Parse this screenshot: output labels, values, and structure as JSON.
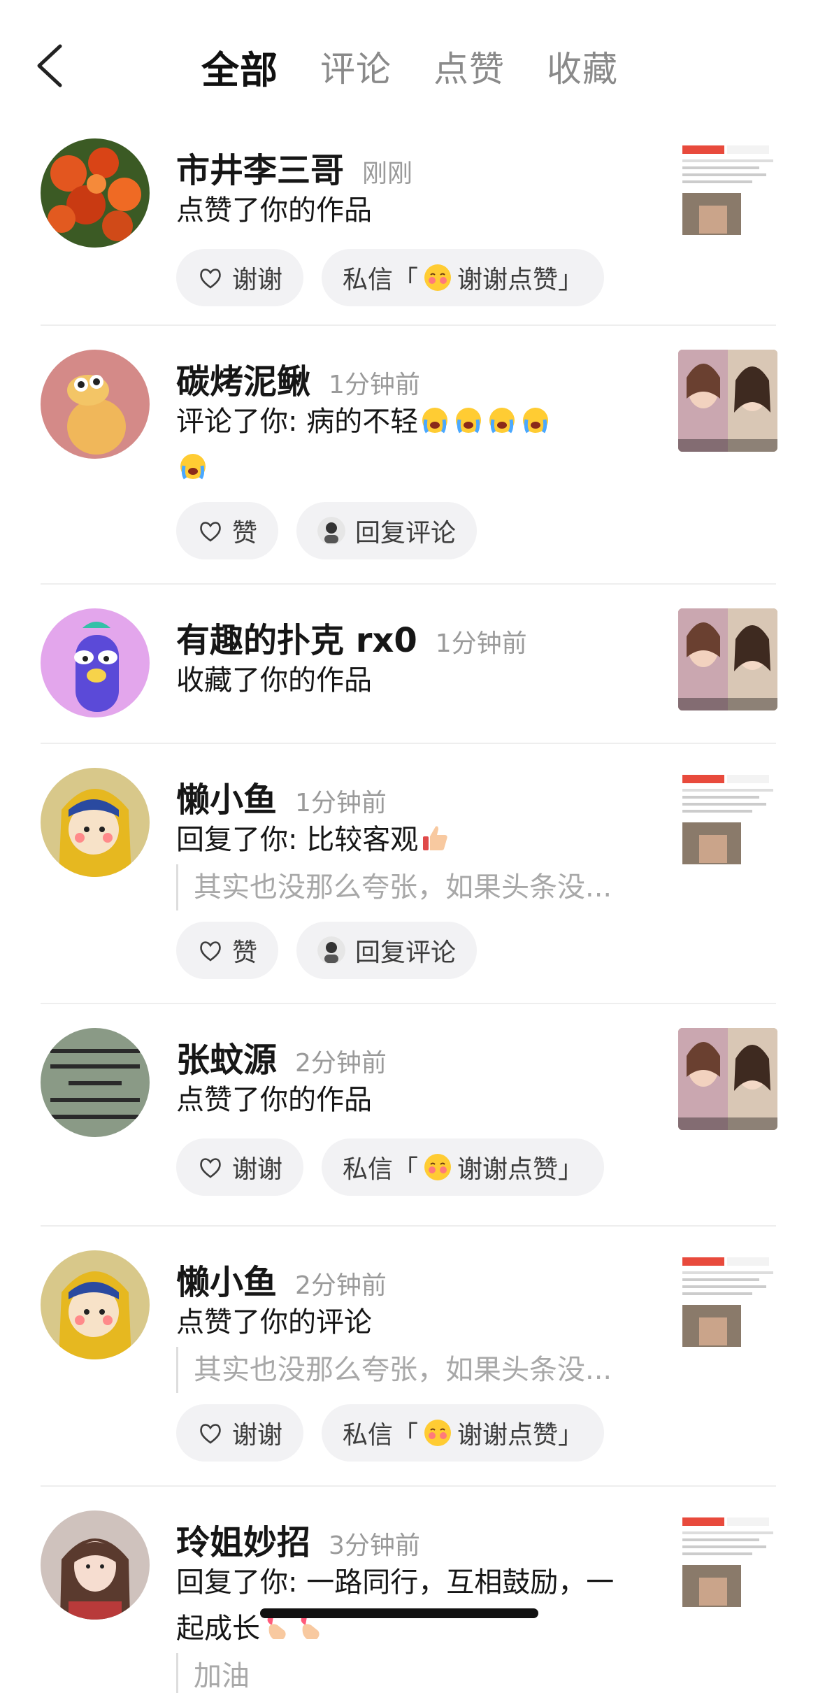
{
  "header": {
    "tabs": [
      "全部",
      "评论",
      "点赞",
      "收藏"
    ],
    "active_tab": 0
  },
  "items": [
    {
      "name": "市井李三哥",
      "time": "刚刚",
      "action": "点赞了你的作品",
      "quote": "",
      "avatar": "red-flowers-avatar",
      "thumb": "screenshot-thumb",
      "buttons": [
        {
          "icon": "heart-hands-icon",
          "label": "谢谢"
        },
        {
          "icon": "",
          "label_before": "私信「",
          "emoji": "blush-emoji",
          "label_after": "谢谢点赞」"
        }
      ]
    },
    {
      "name": "碳烤泥鳅",
      "time": "1分钟前",
      "action": "评论了你: 病的不轻",
      "quote": "",
      "avatar": "cartoon-loach-avatar",
      "thumb": "video-thumb",
      "emojis": [
        "crying-emoji",
        "crying-emoji",
        "crying-emoji",
        "crying-emoji",
        "crying-emoji"
      ],
      "buttons": [
        {
          "icon": "heart-outline-icon",
          "label": "赞"
        },
        {
          "icon": "user-mini-avatar",
          "label": "回复评论"
        }
      ]
    },
    {
      "name": "有趣的扑克 rx0",
      "time": "1分钟前",
      "action": "收藏了你的作品",
      "quote": "",
      "avatar": "purple-cartoon-avatar",
      "thumb": "video-thumb",
      "buttons": []
    },
    {
      "name": "懒小鱼",
      "time": "1分钟前",
      "action": "回复了你: 比较客观",
      "quote": "其实也没那么夸张，如果头条没...",
      "avatar": "cartoon-girl-avatar",
      "thumb": "screenshot-thumb",
      "emojis": [
        "thumbs-up-emoji"
      ],
      "buttons": [
        {
          "icon": "heart-outline-icon",
          "label": "赞"
        },
        {
          "icon": "user-mini-avatar",
          "label": "回复评论"
        }
      ]
    },
    {
      "name": "张蚊源",
      "time": "2分钟前",
      "action": "点赞了你的作品",
      "quote": "",
      "avatar": "calligraphy-avatar",
      "thumb": "video-thumb",
      "buttons": [
        {
          "icon": "heart-hands-icon",
          "label": "谢谢"
        },
        {
          "icon": "",
          "label_before": "私信「",
          "emoji": "blush-emoji",
          "label_after": "谢谢点赞」"
        }
      ]
    },
    {
      "name": "懒小鱼",
      "time": "2分钟前",
      "action": "点赞了你的评论",
      "quote": "其实也没那么夸张，如果头条没...",
      "avatar": "cartoon-girl-avatar",
      "thumb": "screenshot-thumb",
      "buttons": [
        {
          "icon": "heart-hands-icon",
          "label": "谢谢"
        },
        {
          "icon": "",
          "label_before": "私信「",
          "emoji": "blush-emoji",
          "label_after": "谢谢点赞」"
        }
      ]
    },
    {
      "name": "玲姐妙招",
      "time": "3分钟前",
      "action": "回复了你: 一路同行，互相鼓励，一起成长",
      "quote": "加油",
      "avatar": "woman-portrait-avatar",
      "thumb": "screenshot-thumb",
      "emojis": [
        "finger-heart-emoji",
        "finger-heart-emoji"
      ],
      "buttons": []
    }
  ],
  "colors": {
    "text_primary": "#161616",
    "text_secondary": "#9a9a9a",
    "button_bg": "#f2f2f4",
    "accent_red": "#e84a3c"
  }
}
